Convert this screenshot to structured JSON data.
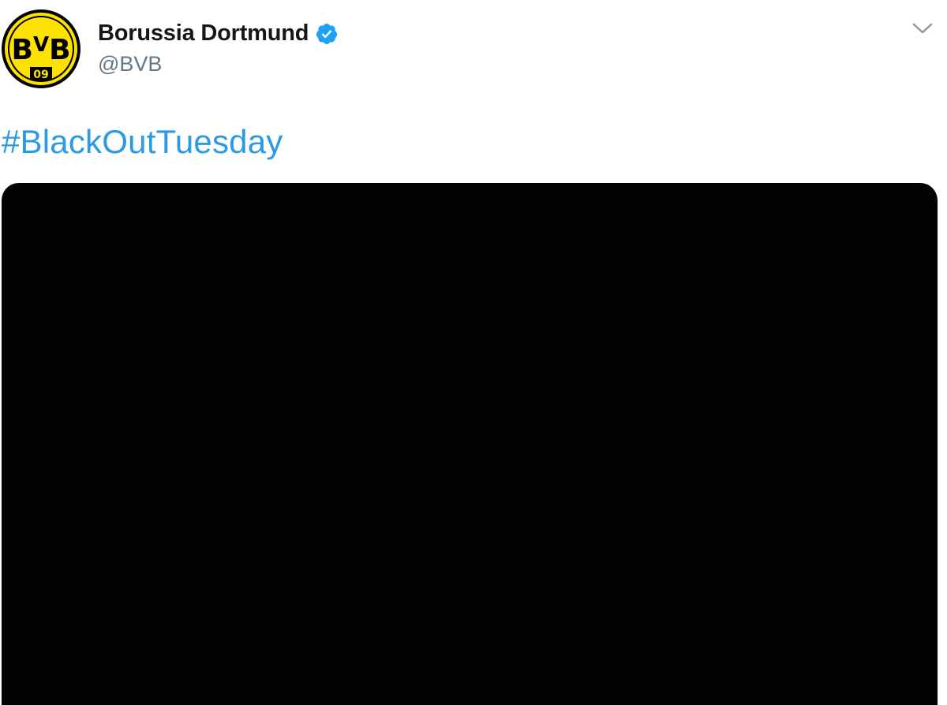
{
  "tweet": {
    "author": {
      "display_name": "Borussia Dortmund",
      "handle": "@BVB",
      "verified": true,
      "avatar_icon": "bvb-crest-icon",
      "avatar_text": "BVB 09",
      "verified_icon": "verified-badge-icon"
    },
    "menu_icon": "chevron-down-icon",
    "text": "#BlackOutTuesday",
    "media": {
      "kind": "image",
      "description_color": "#000000"
    }
  },
  "colors": {
    "hashtag": "#2b9ae0",
    "name": "#14171a",
    "handle": "#657786",
    "verified": "#1da1f2",
    "crest_yellow": "#fde100",
    "crest_black": "#000000"
  }
}
